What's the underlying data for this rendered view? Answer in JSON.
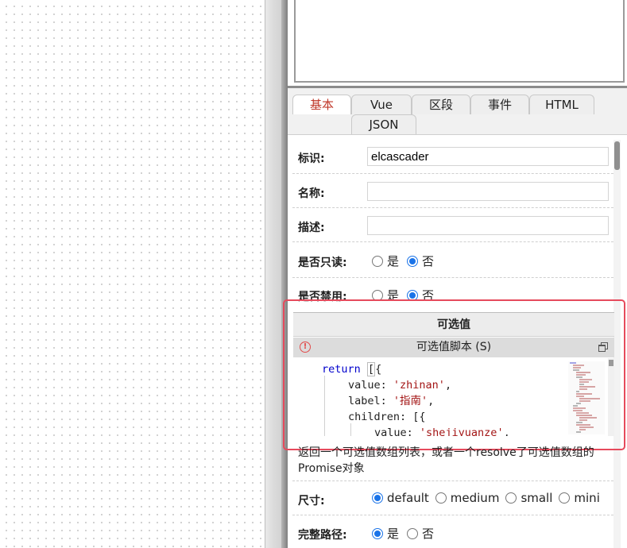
{
  "tabs": [
    {
      "label": "基本",
      "active": true
    },
    {
      "label": "Vue",
      "active": false
    },
    {
      "label": "区段",
      "active": false
    },
    {
      "label": "事件",
      "active": false
    },
    {
      "label": "HTML",
      "active": false
    },
    {
      "label": "JSON",
      "active": false
    }
  ],
  "form": {
    "id_label": "标识:",
    "id_value": "elcascader",
    "name_label": "名称:",
    "name_value": "",
    "desc_label": "描述:",
    "desc_value": "",
    "readonly_label": "是否只读:",
    "readonly_options": [
      "是",
      "否"
    ],
    "readonly_selected": "否",
    "disabled_label": "是否禁用:",
    "disabled_options": [
      "是",
      "否"
    ],
    "disabled_selected": "否"
  },
  "options_section": {
    "header": "可选值",
    "script_title": "可选值脚本 (S)",
    "error_icon": "error-circle-icon",
    "restore_icon": "restore-window-icon",
    "code_lines": [
      {
        "text": "return [{",
        "indent": 0
      },
      {
        "text": "value: 'zhinan',",
        "indent": 1
      },
      {
        "text": "label: '指南',",
        "indent": 1
      },
      {
        "text": "children: [{",
        "indent": 1
      },
      {
        "text": "value: 'shejiyuanze',",
        "indent": 2
      }
    ],
    "description": "返回一个可选值数组列表，或者一个resolve了可选值数组的Promise对象"
  },
  "size": {
    "label": "尺寸:",
    "options": [
      "default",
      "medium",
      "small",
      "mini"
    ],
    "selected": "default"
  },
  "full_path": {
    "label": "完整路径:",
    "options": [
      "是",
      "否"
    ],
    "selected": "是"
  },
  "colors": {
    "accent": "#1a73e8",
    "active_tab": "#c0392b",
    "highlight_border": "#e64a5c",
    "keyword": "#0000cc",
    "string": "#a31515"
  }
}
